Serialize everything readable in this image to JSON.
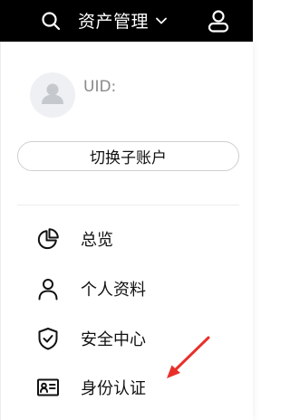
{
  "header": {
    "menu_title": "资产管理",
    "icons": [
      "search-icon",
      "chevron-down-icon",
      "user-icon"
    ]
  },
  "account": {
    "uid_label": "UID:",
    "switch_label": "切换子账户"
  },
  "menu": {
    "items": [
      {
        "label": "总览",
        "icon": "pie-chart-icon"
      },
      {
        "label": "个人资料",
        "icon": "person-icon"
      },
      {
        "label": "安全中心",
        "icon": "shield-check-icon"
      },
      {
        "label": "身份认证",
        "icon": "id-card-icon"
      }
    ]
  },
  "annotation": {
    "arrow_color": "#e8302b"
  },
  "colors": {
    "header_bg": "#000000",
    "text": "#111111",
    "muted": "#8a8a8a"
  }
}
